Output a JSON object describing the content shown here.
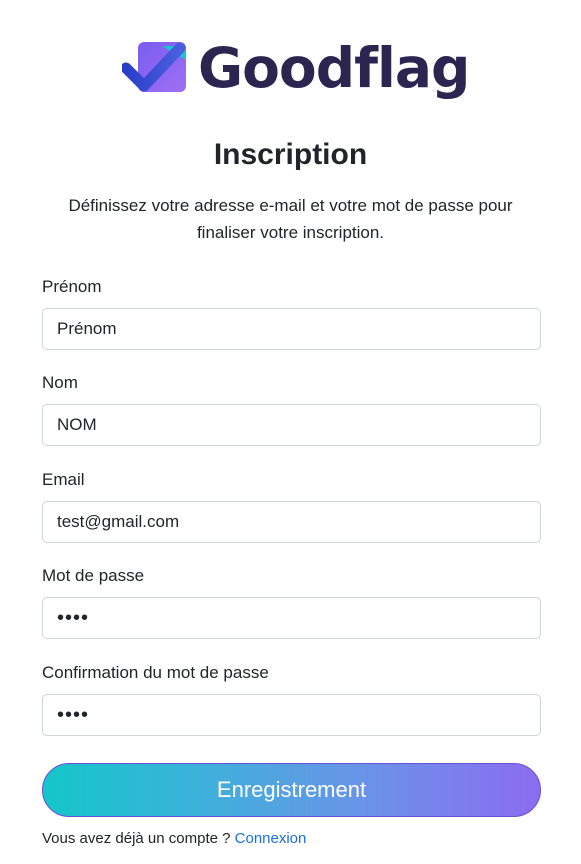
{
  "brand": {
    "name": "Goodflag",
    "colors": {
      "text": "#2b2550",
      "mark_blue": "#3a4fd0",
      "mark_purple": "#8a5cf0",
      "mark_cyan": "#19c6cc"
    },
    "icon": "checkmark-flag-logo"
  },
  "header": {
    "title": "Inscription",
    "subtitle": "Définissez votre adresse e-mail et votre mot de passe pour finaliser votre inscription."
  },
  "form": {
    "first_name": {
      "label": "Prénom",
      "value": "Prénom"
    },
    "last_name": {
      "label": "Nom",
      "value": "NOM"
    },
    "email": {
      "label": "Email",
      "value": "test@gmail.com"
    },
    "password": {
      "label": "Mot de passe",
      "value": "••••"
    },
    "password_confirm": {
      "label": "Confirmation du mot de passe",
      "value": "••••"
    },
    "submit_label": "Enregistrement"
  },
  "footer": {
    "prompt": "Vous avez déjà un compte ? ",
    "login_link": "Connexion",
    "link_color": "#1a6fe0"
  }
}
